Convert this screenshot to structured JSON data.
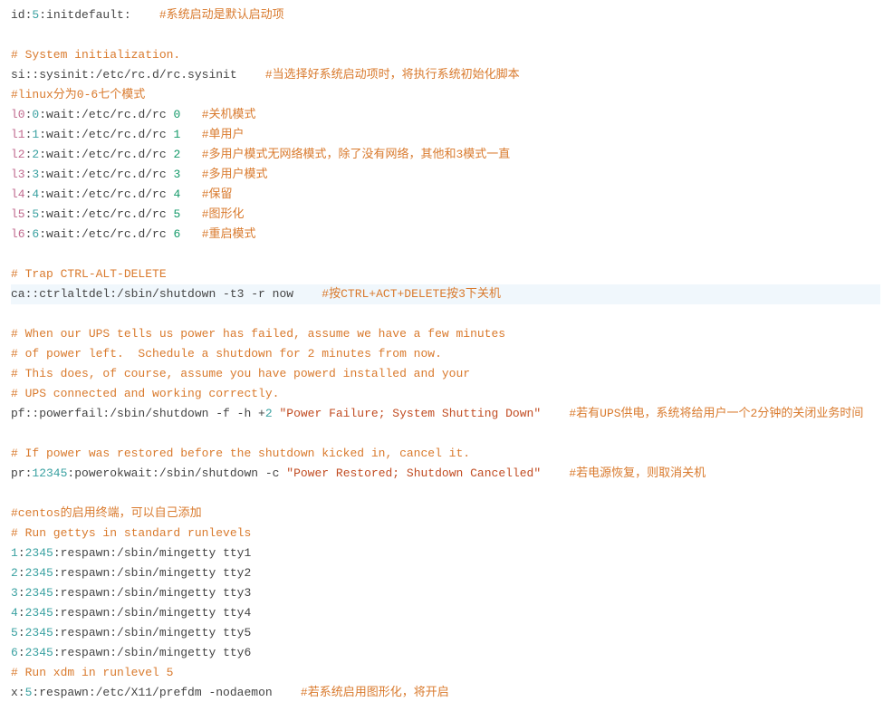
{
  "lines": [
    {
      "a": "id:",
      "b": "5",
      "c": ":initdefault:",
      "cm": "#系统启动是默认启动项"
    },
    {
      "raw": ""
    },
    {
      "cm": "# System initialization."
    },
    {
      "a": "si::sysinit:",
      "p": "/etc/rc.d/rc.sysinit",
      "cm": "#当选择好系统启动项时，将执行系统初始化脚本"
    },
    {
      "cm": "#linux分为0-6七个模式"
    },
    {
      "lv": "l0",
      "n": "0",
      "p": ":wait:/etc/rc.d/rc ",
      "rn": "0",
      "cm": "#关机模式"
    },
    {
      "lv": "l1",
      "n": "1",
      "p": ":wait:/etc/rc.d/rc ",
      "rn": "1",
      "cm": "#单用户"
    },
    {
      "lv": "l2",
      "n": "2",
      "p": ":wait:/etc/rc.d/rc ",
      "rn": "2",
      "cm": "#多用户模式无网络模式，除了没有网络，其他和3模式一直"
    },
    {
      "lv": "l3",
      "n": "3",
      "p": ":wait:/etc/rc.d/rc ",
      "rn": "3",
      "cm": "#多用户模式"
    },
    {
      "lv": "l4",
      "n": "4",
      "p": ":wait:/etc/rc.d/rc ",
      "rn": "4",
      "cm": "#保留"
    },
    {
      "lv": "l5",
      "n": "5",
      "p": ":wait:/etc/rc.d/rc ",
      "rn": "5",
      "cm": "#图形化"
    },
    {
      "lv": "l6",
      "n": "6",
      "p": ":wait:/etc/rc.d/rc ",
      "rn": "6",
      "cm": "#重启模式"
    },
    {
      "raw": ""
    },
    {
      "cm": "# Trap CTRL-ALT-DELETE"
    },
    {
      "hl": true,
      "a": "ca::ctrlaltdel:",
      "p": "/sbin/shutdown -t3 -r now",
      "cm": "#按CTRL+ACT+DELETE按3下关机"
    },
    {
      "raw": ""
    },
    {
      "cm": "# When our UPS tells us power has failed, assume we have a few minutes"
    },
    {
      "cm": "# of power left.  Schedule a shutdown for 2 minutes from now."
    },
    {
      "cm": "# This does, of course, assume you have powerd installed and your"
    },
    {
      "cm": "# UPS connected and working correctly."
    },
    {
      "a": "pf::powerfail:",
      "p": "/sbin/shutdown -f -h +",
      "rn": "2",
      "s": " \"Power Failure; System Shutting Down\"",
      "cm": "#若有UPS供电，系统将给用户一个2分钟的关闭业务时间"
    },
    {
      "raw": ""
    },
    {
      "cm": "# If power was restored before the shutdown kicked in, cancel it."
    },
    {
      "a": "pr:",
      "nmid": "12345",
      "a2": ":powerokwait:",
      "p": "/sbin/shutdown -c ",
      "s": "\"Power Restored; Shutdown Cancelled\"",
      "cm": "#若电源恢复，则取消关机"
    },
    {
      "raw": ""
    },
    {
      "cm": "#centos的启用终端，可以自己添加"
    },
    {
      "cm": "# Run gettys in standard runlevels"
    },
    {
      "lv2": "1",
      "nmid": "2345",
      "p": ":respawn:/sbin/mingetty tty1"
    },
    {
      "lv2": "2",
      "nmid": "2345",
      "p": ":respawn:/sbin/mingetty tty2"
    },
    {
      "lv2": "3",
      "nmid": "2345",
      "p": ":respawn:/sbin/mingetty tty3"
    },
    {
      "lv2": "4",
      "nmid": "2345",
      "p": ":respawn:/sbin/mingetty tty4"
    },
    {
      "lv2": "5",
      "nmid": "2345",
      "p": ":respawn:/sbin/mingetty tty5"
    },
    {
      "lv2": "6",
      "nmid": "2345",
      "p": ":respawn:/sbin/mingetty tty6"
    },
    {
      "cm": "# Run xdm in runlevel 5"
    },
    {
      "a": "x:",
      "nmid": "5",
      "p": ":respawn:/etc/X11/prefdm -nodaemon",
      "cm": "#若系统启用图形化，将开启"
    }
  ]
}
